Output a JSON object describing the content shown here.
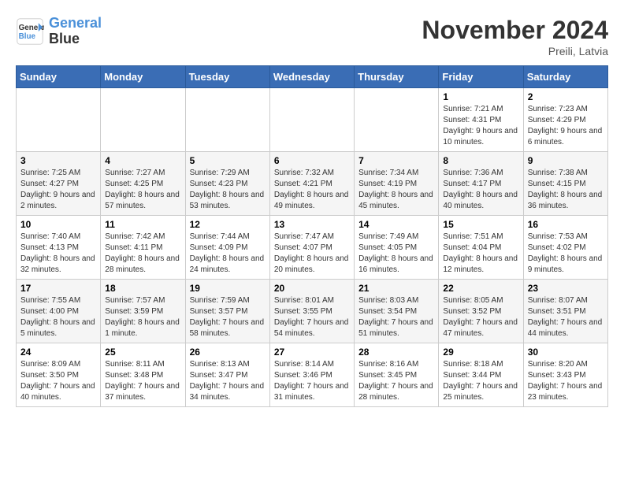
{
  "header": {
    "logo_line1": "General",
    "logo_line2": "Blue",
    "month_title": "November 2024",
    "subtitle": "Preili, Latvia"
  },
  "days_of_week": [
    "Sunday",
    "Monday",
    "Tuesday",
    "Wednesday",
    "Thursday",
    "Friday",
    "Saturday"
  ],
  "weeks": [
    [
      {
        "day": "",
        "info": ""
      },
      {
        "day": "",
        "info": ""
      },
      {
        "day": "",
        "info": ""
      },
      {
        "day": "",
        "info": ""
      },
      {
        "day": "",
        "info": ""
      },
      {
        "day": "1",
        "info": "Sunrise: 7:21 AM\nSunset: 4:31 PM\nDaylight: 9 hours and 10 minutes."
      },
      {
        "day": "2",
        "info": "Sunrise: 7:23 AM\nSunset: 4:29 PM\nDaylight: 9 hours and 6 minutes."
      }
    ],
    [
      {
        "day": "3",
        "info": "Sunrise: 7:25 AM\nSunset: 4:27 PM\nDaylight: 9 hours and 2 minutes."
      },
      {
        "day": "4",
        "info": "Sunrise: 7:27 AM\nSunset: 4:25 PM\nDaylight: 8 hours and 57 minutes."
      },
      {
        "day": "5",
        "info": "Sunrise: 7:29 AM\nSunset: 4:23 PM\nDaylight: 8 hours and 53 minutes."
      },
      {
        "day": "6",
        "info": "Sunrise: 7:32 AM\nSunset: 4:21 PM\nDaylight: 8 hours and 49 minutes."
      },
      {
        "day": "7",
        "info": "Sunrise: 7:34 AM\nSunset: 4:19 PM\nDaylight: 8 hours and 45 minutes."
      },
      {
        "day": "8",
        "info": "Sunrise: 7:36 AM\nSunset: 4:17 PM\nDaylight: 8 hours and 40 minutes."
      },
      {
        "day": "9",
        "info": "Sunrise: 7:38 AM\nSunset: 4:15 PM\nDaylight: 8 hours and 36 minutes."
      }
    ],
    [
      {
        "day": "10",
        "info": "Sunrise: 7:40 AM\nSunset: 4:13 PM\nDaylight: 8 hours and 32 minutes."
      },
      {
        "day": "11",
        "info": "Sunrise: 7:42 AM\nSunset: 4:11 PM\nDaylight: 8 hours and 28 minutes."
      },
      {
        "day": "12",
        "info": "Sunrise: 7:44 AM\nSunset: 4:09 PM\nDaylight: 8 hours and 24 minutes."
      },
      {
        "day": "13",
        "info": "Sunrise: 7:47 AM\nSunset: 4:07 PM\nDaylight: 8 hours and 20 minutes."
      },
      {
        "day": "14",
        "info": "Sunrise: 7:49 AM\nSunset: 4:05 PM\nDaylight: 8 hours and 16 minutes."
      },
      {
        "day": "15",
        "info": "Sunrise: 7:51 AM\nSunset: 4:04 PM\nDaylight: 8 hours and 12 minutes."
      },
      {
        "day": "16",
        "info": "Sunrise: 7:53 AM\nSunset: 4:02 PM\nDaylight: 8 hours and 9 minutes."
      }
    ],
    [
      {
        "day": "17",
        "info": "Sunrise: 7:55 AM\nSunset: 4:00 PM\nDaylight: 8 hours and 5 minutes."
      },
      {
        "day": "18",
        "info": "Sunrise: 7:57 AM\nSunset: 3:59 PM\nDaylight: 8 hours and 1 minute."
      },
      {
        "day": "19",
        "info": "Sunrise: 7:59 AM\nSunset: 3:57 PM\nDaylight: 7 hours and 58 minutes."
      },
      {
        "day": "20",
        "info": "Sunrise: 8:01 AM\nSunset: 3:55 PM\nDaylight: 7 hours and 54 minutes."
      },
      {
        "day": "21",
        "info": "Sunrise: 8:03 AM\nSunset: 3:54 PM\nDaylight: 7 hours and 51 minutes."
      },
      {
        "day": "22",
        "info": "Sunrise: 8:05 AM\nSunset: 3:52 PM\nDaylight: 7 hours and 47 minutes."
      },
      {
        "day": "23",
        "info": "Sunrise: 8:07 AM\nSunset: 3:51 PM\nDaylight: 7 hours and 44 minutes."
      }
    ],
    [
      {
        "day": "24",
        "info": "Sunrise: 8:09 AM\nSunset: 3:50 PM\nDaylight: 7 hours and 40 minutes."
      },
      {
        "day": "25",
        "info": "Sunrise: 8:11 AM\nSunset: 3:48 PM\nDaylight: 7 hours and 37 minutes."
      },
      {
        "day": "26",
        "info": "Sunrise: 8:13 AM\nSunset: 3:47 PM\nDaylight: 7 hours and 34 minutes."
      },
      {
        "day": "27",
        "info": "Sunrise: 8:14 AM\nSunset: 3:46 PM\nDaylight: 7 hours and 31 minutes."
      },
      {
        "day": "28",
        "info": "Sunrise: 8:16 AM\nSunset: 3:45 PM\nDaylight: 7 hours and 28 minutes."
      },
      {
        "day": "29",
        "info": "Sunrise: 8:18 AM\nSunset: 3:44 PM\nDaylight: 7 hours and 25 minutes."
      },
      {
        "day": "30",
        "info": "Sunrise: 8:20 AM\nSunset: 3:43 PM\nDaylight: 7 hours and 23 minutes."
      }
    ]
  ]
}
